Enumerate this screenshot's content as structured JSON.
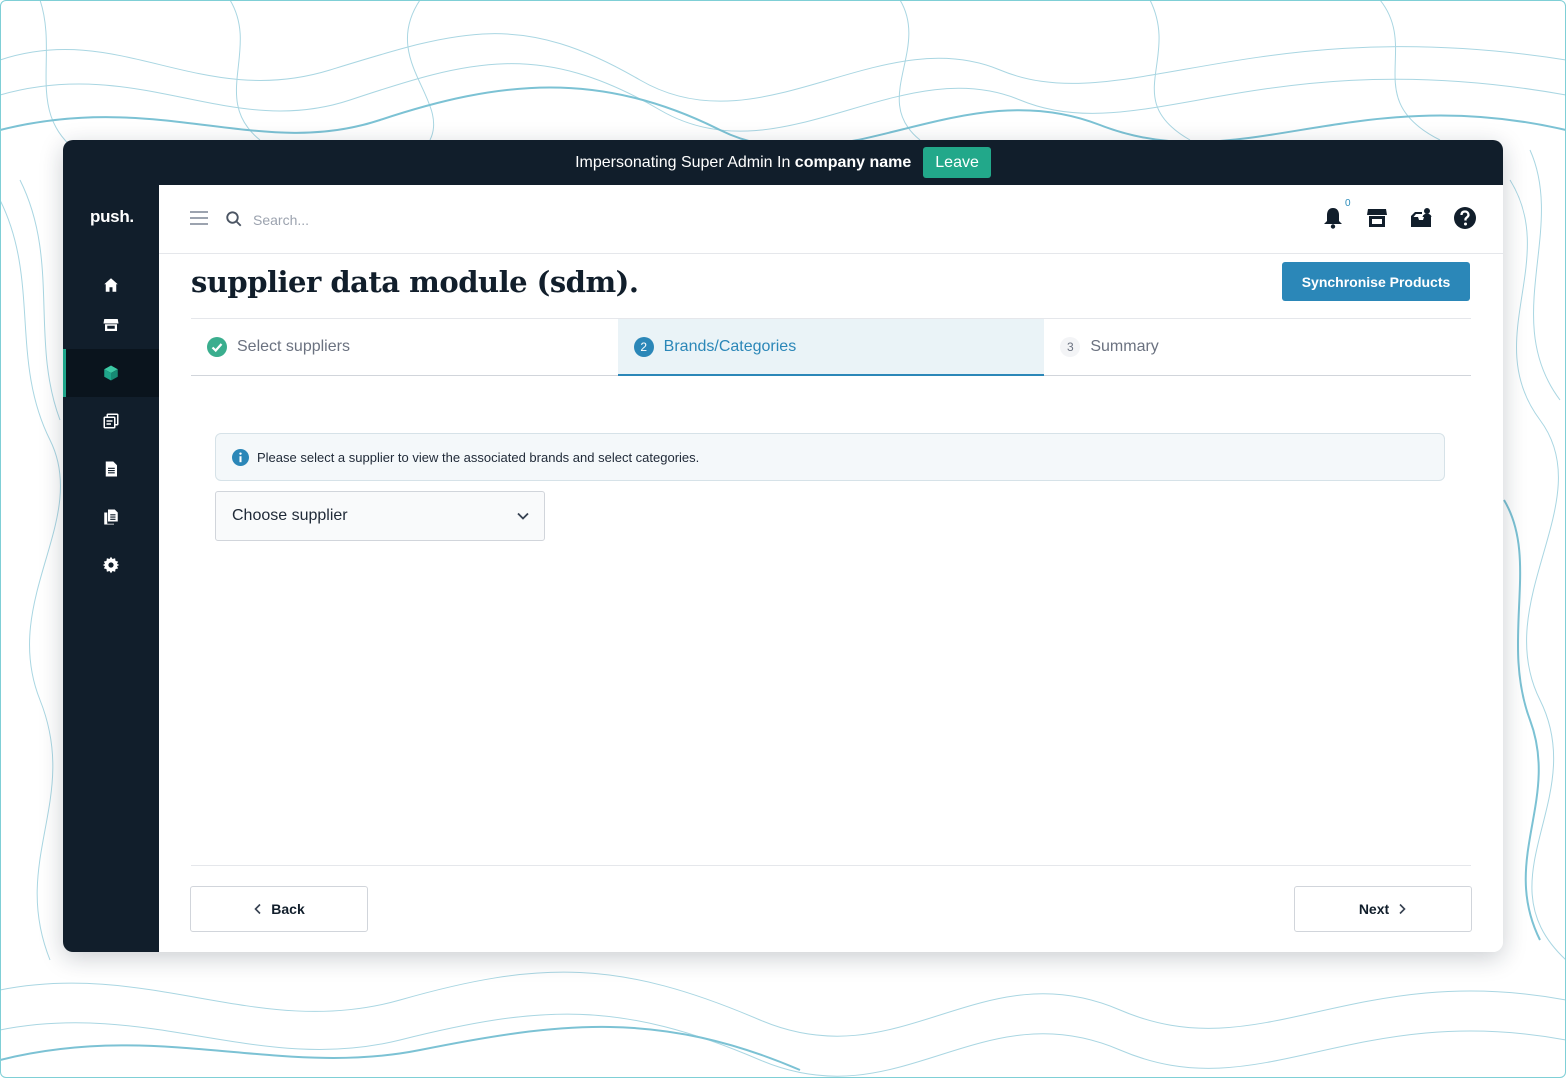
{
  "impersonation": {
    "prefix": "Impersonating Super Admin In",
    "company": "company name",
    "leave_label": "Leave"
  },
  "sidebar": {
    "logo": "push.",
    "items": [
      {
        "icon": "home-icon"
      },
      {
        "icon": "store-icon"
      },
      {
        "icon": "cube-icon",
        "active": true
      },
      {
        "icon": "copy-icon"
      },
      {
        "icon": "document-icon"
      },
      {
        "icon": "files-icon"
      },
      {
        "icon": "gear-icon"
      }
    ]
  },
  "header": {
    "search_placeholder": "Search...",
    "notification_count": "0"
  },
  "page": {
    "title": "supplier data module (sdm).",
    "sync_label": "Synchronise Products"
  },
  "steps": [
    {
      "label": "Select suppliers",
      "status": "complete"
    },
    {
      "number": "2",
      "label": "Brands/Categories",
      "status": "active"
    },
    {
      "number": "3",
      "label": "Summary",
      "status": "pending"
    }
  ],
  "info": {
    "text": "Please select a supplier to view the associated brands and select categories."
  },
  "supplier_select": {
    "value": "Choose supplier"
  },
  "footer": {
    "back_label": "Back",
    "next_label": "Next"
  },
  "colors": {
    "dark": "#111e2b",
    "accent": "#2b87b8",
    "success": "#22a88a"
  }
}
